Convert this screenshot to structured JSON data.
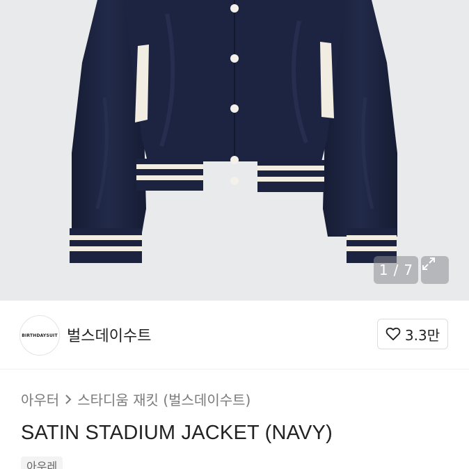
{
  "gallery": {
    "counter_current": "1",
    "counter_sep": "/",
    "counter_total": "7",
    "expand_icon": "expand-arrows-icon",
    "background": "#e9eaec",
    "jacket_color": "#1c2340",
    "stripe_color": "#f1ede2"
  },
  "seller": {
    "avatar_text": "BIRTHDAYSUIT",
    "name": "벌스데이수트",
    "like_icon": "heart-icon",
    "like_count": "3.3만"
  },
  "breadcrumb": {
    "category": "아우터",
    "separator_icon": "chevron-right-icon",
    "subcategory": "스타디움 재킷 (벌스데이수트)"
  },
  "product": {
    "title": "SATIN STADIUM JACKET (NAVY)",
    "tag": "아우레"
  }
}
